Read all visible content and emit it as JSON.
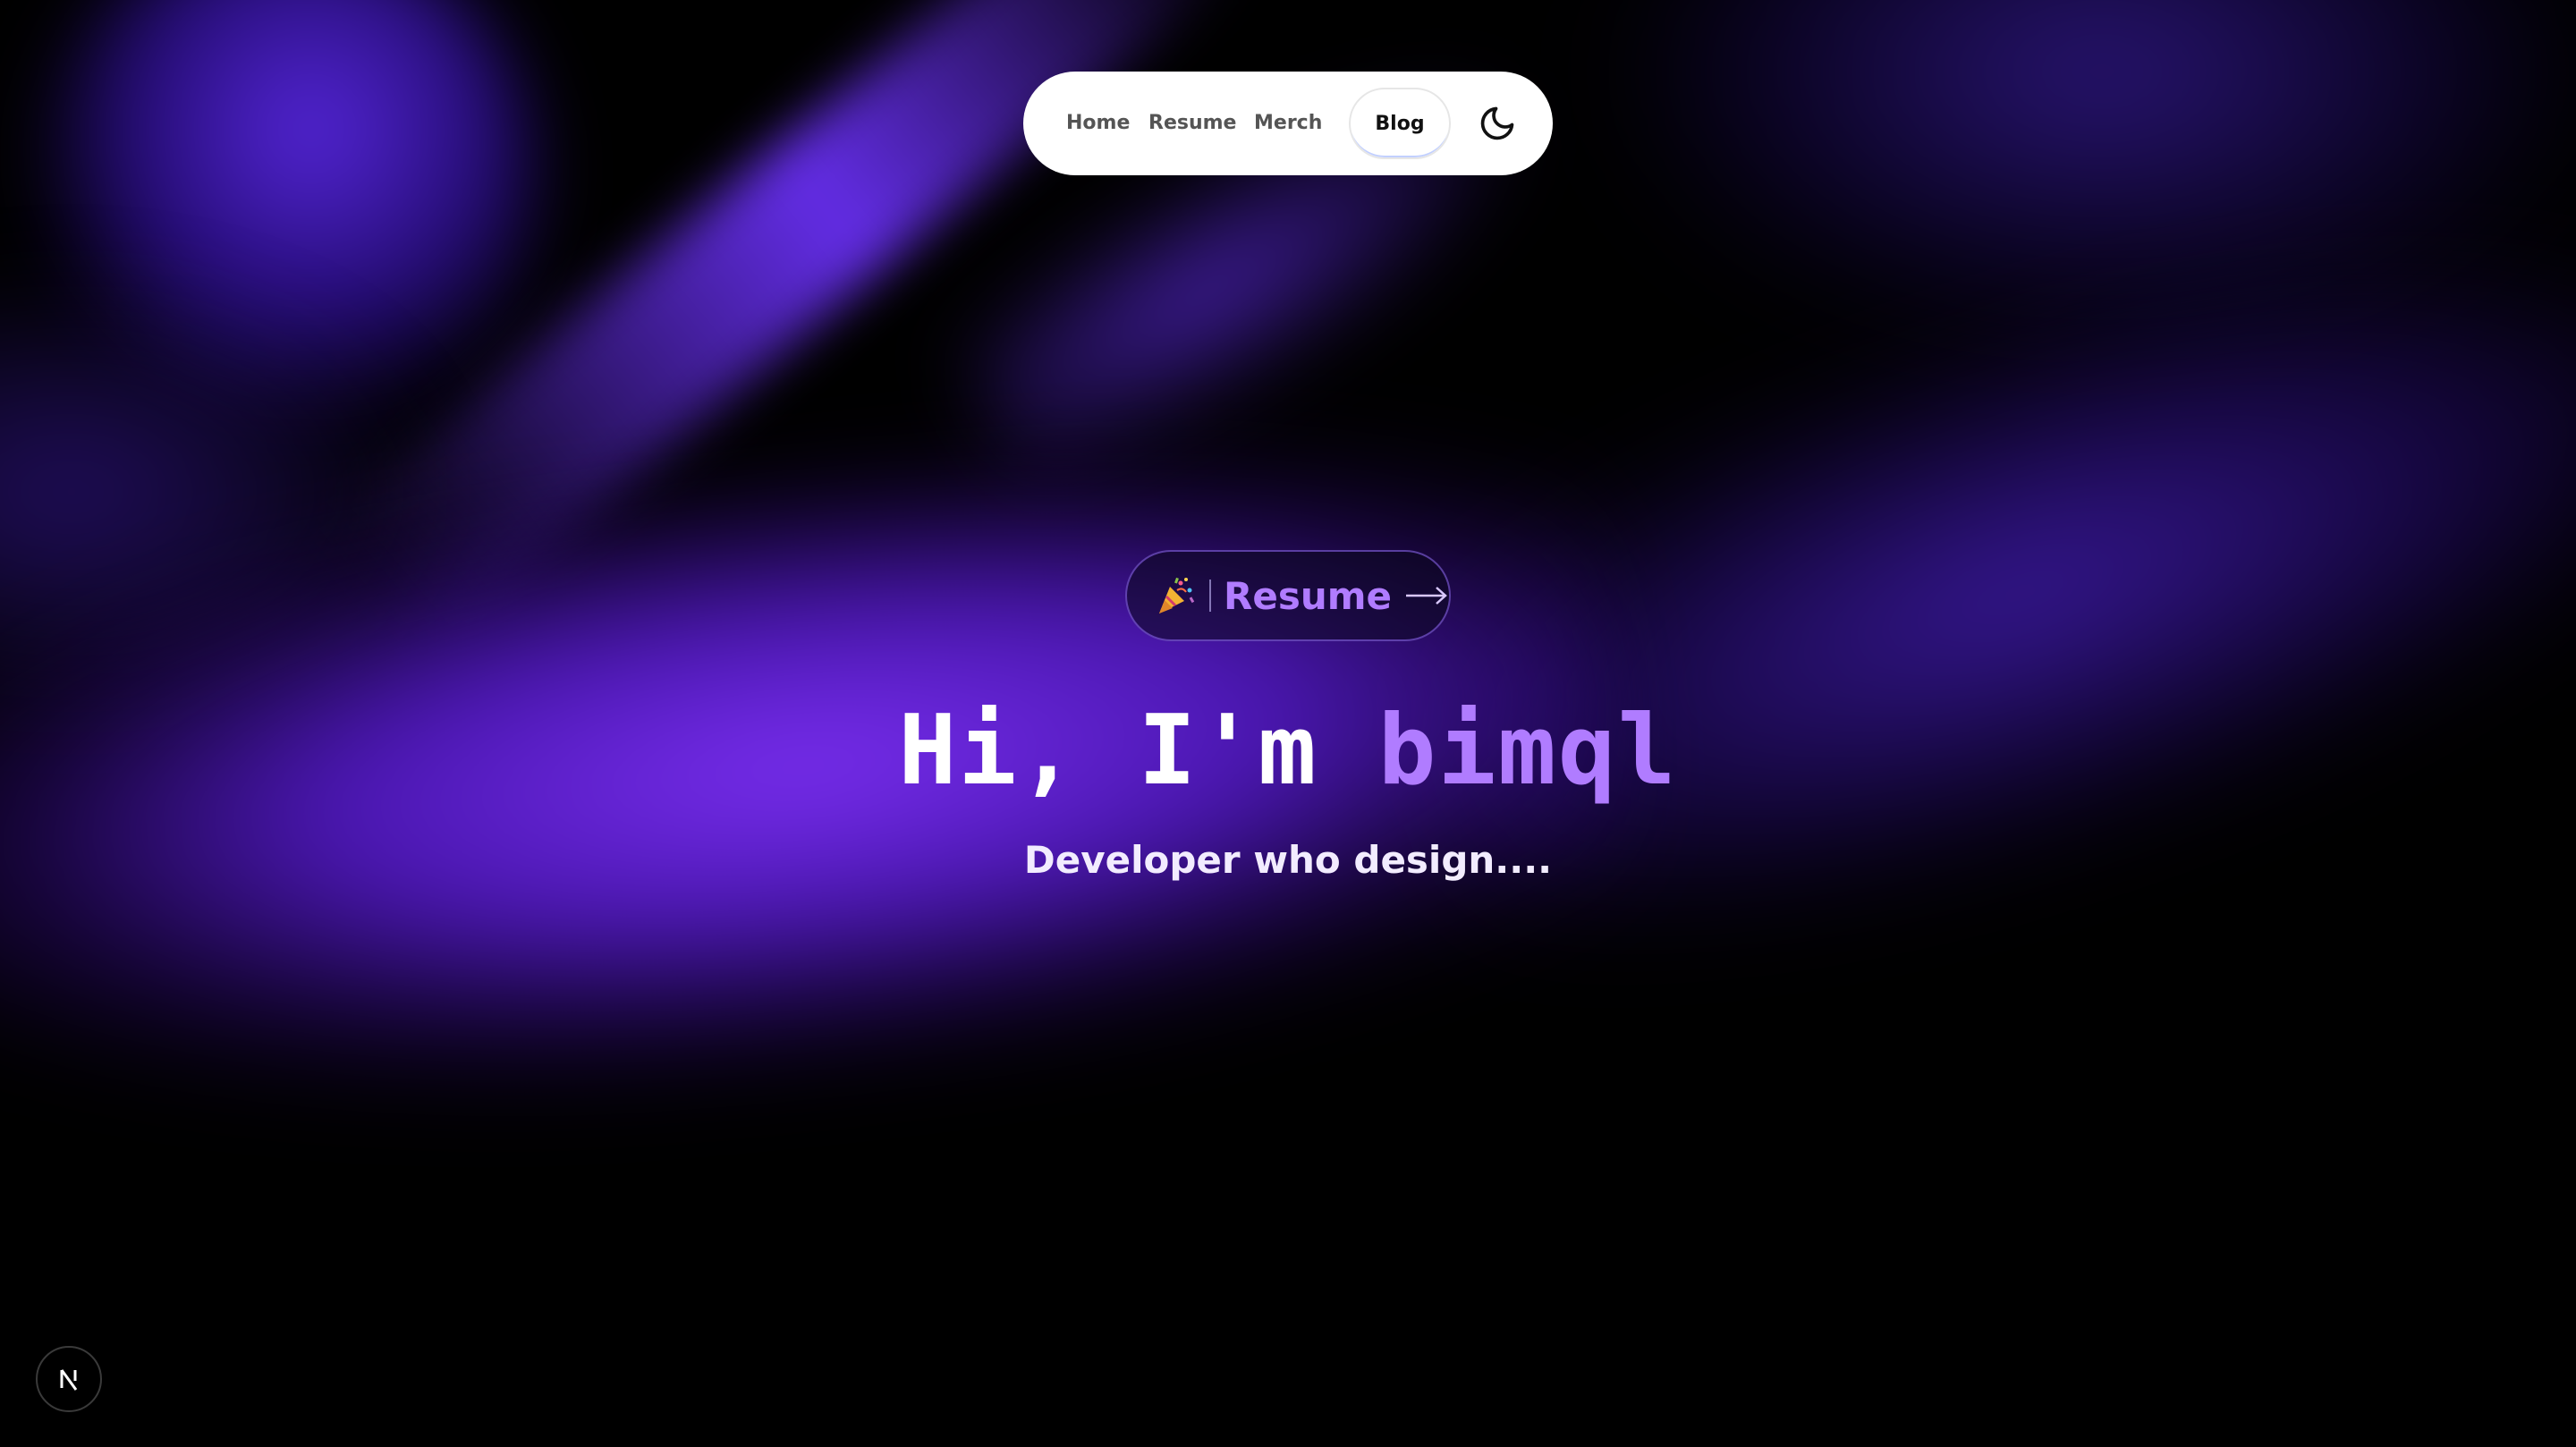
{
  "nav": {
    "items": [
      {
        "label": "Home"
      },
      {
        "label": "Resume"
      },
      {
        "label": "Merch"
      },
      {
        "label": "Blog",
        "active": true
      }
    ],
    "theme_toggle_icon": "moon-icon"
  },
  "hero": {
    "badge": {
      "icon": "party-popper-icon",
      "label": "Resume",
      "arrow_icon": "arrow-right-icon"
    },
    "greeting": "Hi, I'm",
    "name": "bimql",
    "tagline": "Developer who design...."
  },
  "dev_badge": {
    "icon": "nextjs-logo-icon"
  },
  "colors": {
    "background": "#000000",
    "accent": "#b07cff",
    "glow": "#6a2cf0",
    "nav_bg": "#ffffff"
  }
}
